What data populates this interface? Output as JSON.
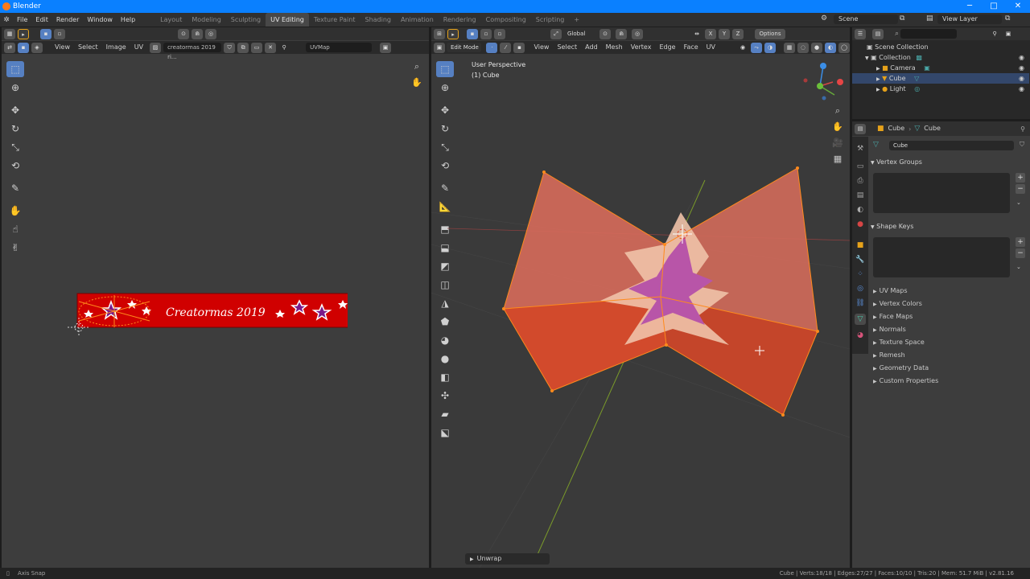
{
  "window": {
    "title": "Blender",
    "minimize": "─",
    "maximize": "□",
    "close": "✕"
  },
  "menu": [
    "File",
    "Edit",
    "Render",
    "Window",
    "Help"
  ],
  "workspaces": [
    {
      "label": "Layout",
      "active": false
    },
    {
      "label": "Modeling",
      "active": false
    },
    {
      "label": "Sculpting",
      "active": false
    },
    {
      "label": "UV Editing",
      "active": true
    },
    {
      "label": "Texture Paint",
      "active": false
    },
    {
      "label": "Shading",
      "active": false
    },
    {
      "label": "Animation",
      "active": false
    },
    {
      "label": "Rendering",
      "active": false
    },
    {
      "label": "Compositing",
      "active": false
    },
    {
      "label": "Scripting",
      "active": false
    }
  ],
  "add_workspace": "+",
  "scene": {
    "name": "Scene",
    "view_layer": "View Layer"
  },
  "uv_editor": {
    "menus": [
      "View",
      "Select",
      "Image",
      "UV"
    ],
    "image_name": "creatormas 2019 ri...",
    "uv_map": "UVMap",
    "banner_text": "Creatormas 2019",
    "banner_color": "#d00000"
  },
  "viewport": {
    "mode": "Edit Mode",
    "menus": [
      "View",
      "Select",
      "Add",
      "Mesh",
      "Vertex",
      "Edge",
      "Face",
      "UV"
    ],
    "transform_orientation": "Global",
    "xyz": [
      "X",
      "Y",
      "Z"
    ],
    "options": "Options",
    "info_line1": "User Perspective",
    "info_line2": "(1) Cube",
    "unwrap_panel": "Unwrap"
  },
  "outliner": {
    "root": "Scene Collection",
    "collection": "Collection",
    "items": [
      {
        "label": "Camera",
        "selected": false
      },
      {
        "label": "Cube",
        "selected": true
      },
      {
        "label": "Light",
        "selected": false
      }
    ]
  },
  "properties": {
    "breadcrumb_object": "Cube",
    "breadcrumb_data": "Cube",
    "data_name": "Cube",
    "vertex_groups": "Vertex Groups",
    "shape_keys": "Shape Keys",
    "collapsed_panels": [
      "UV Maps",
      "Vertex Colors",
      "Face Maps",
      "Normals",
      "Texture Space",
      "Remesh",
      "Geometry Data",
      "Custom Properties"
    ]
  },
  "statusbar": {
    "left": "Axis Snap",
    "right": "Cube | Verts:18/18 | Edges:27/27 | Faces:10/10 | Tris:20 | Mem: 51.7 MiB | v2.81.16"
  },
  "colors": {
    "accent": "#0a80ff",
    "selection": "#5680c2",
    "mesh_face": "#e04a2e",
    "mesh_edge": "#ff8a1c"
  }
}
